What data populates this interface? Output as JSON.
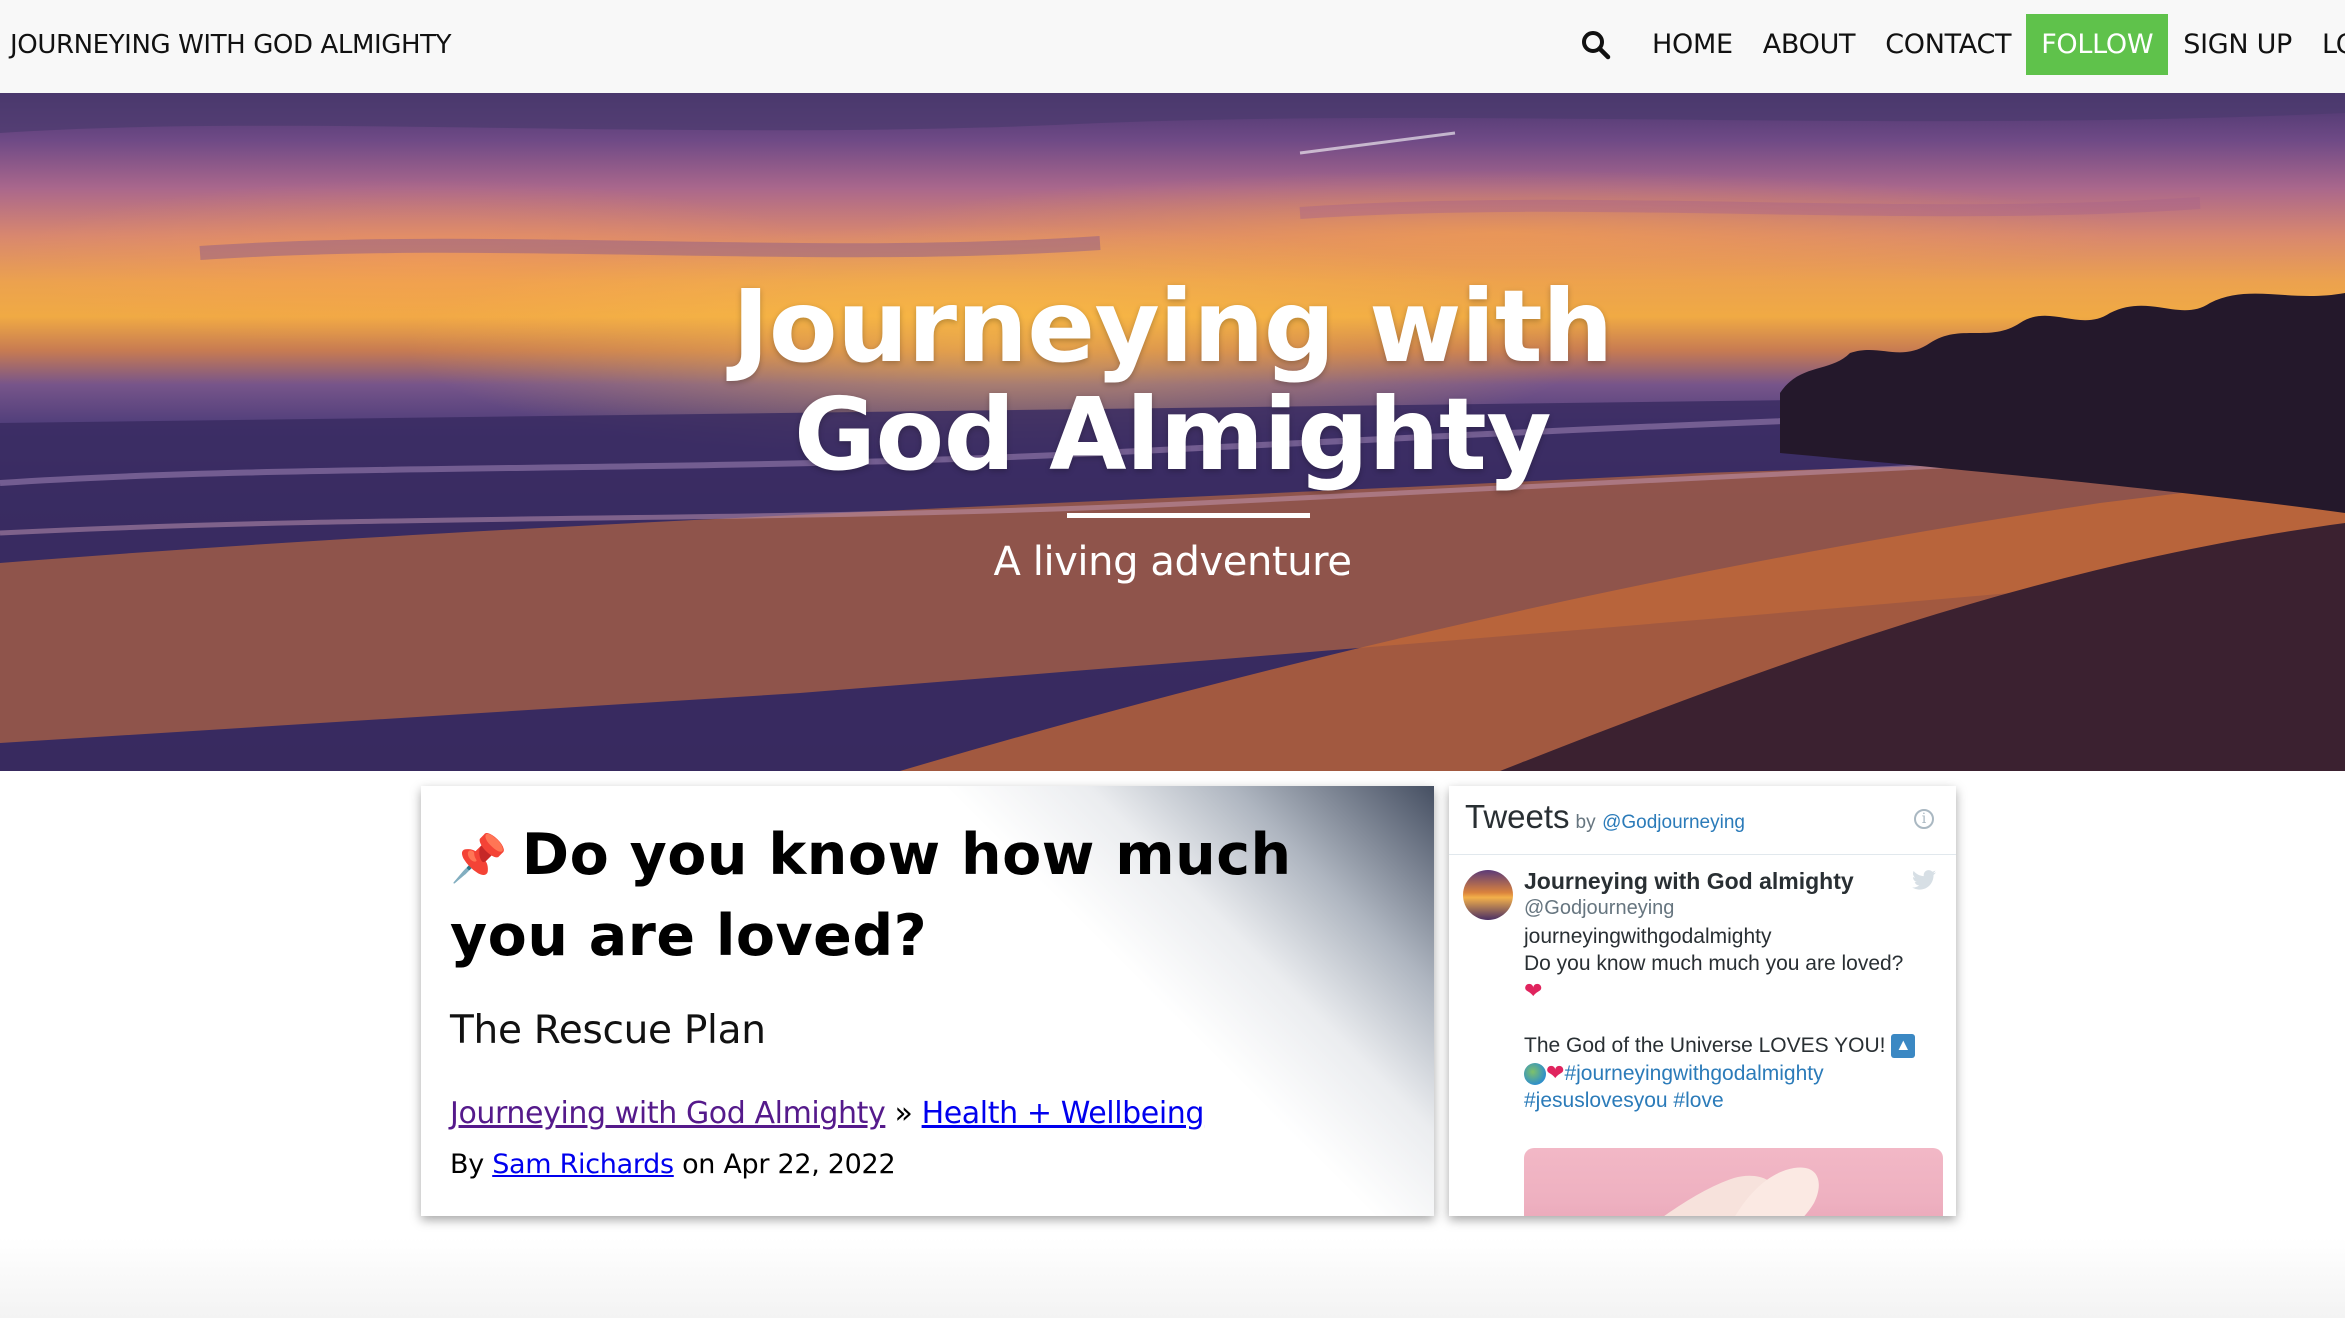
{
  "header": {
    "site_name": "JOURNEYING WITH GOD ALMIGHTY",
    "nav": [
      {
        "label": "HOME"
      },
      {
        "label": "ABOUT"
      },
      {
        "label": "CONTACT"
      },
      {
        "label": "FOLLOW",
        "highlight_color": "#5fc24b"
      },
      {
        "label": "SIGN UP"
      },
      {
        "label": "LOG I"
      }
    ],
    "search_icon": "search-icon"
  },
  "hero": {
    "title_line1": "Journeying with",
    "title_line2": "God Almighty",
    "tagline": "A living adventure"
  },
  "post": {
    "pin_icon": "📌",
    "title": "Do you know how much you are loved?",
    "subtitle": "The Rescue Plan",
    "breadcrumb_home": "Journeying with God Almighty",
    "breadcrumb_separator": "»",
    "breadcrumb_category": "Health + Wellbeing",
    "byline_prefix": "By",
    "author": "Sam Richards",
    "date_text": "on Apr 22, 2022"
  },
  "tweets_widget": {
    "label": "Tweets",
    "by": "by",
    "handle": "@Godjourneying",
    "tweet": {
      "author_name": "Journeying with God almighty",
      "author_handle": "@Godjourneying",
      "line1": "journeyingwithgodalmighty",
      "line2": "Do you know much much you are loved?",
      "heart": "❤",
      "line3": "The God of the Universe LOVES YOU!",
      "arrow": "▲",
      "hashtag1": "#journeyingwithgodalmighty",
      "hashtags2": "#jesuslovesyou #love"
    }
  },
  "colors": {
    "follow_bg": "#5fc24b",
    "link": "#0000ee",
    "visited_link": "#551a8b",
    "twitter_link": "#2b7bb9"
  }
}
